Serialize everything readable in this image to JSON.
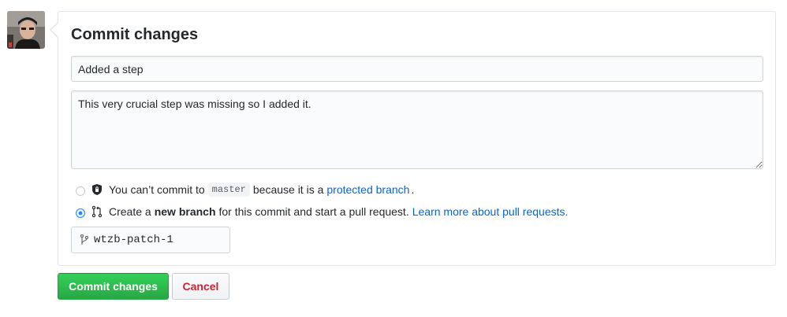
{
  "form": {
    "title": "Commit changes",
    "summary_value": "Added a step",
    "description_value": "This very crucial step was missing so I added it."
  },
  "options": {
    "direct_commit": {
      "text_before": "You can’t commit to",
      "branch": "master",
      "text_middle": "because it is a",
      "link": "protected branch",
      "text_after": "."
    },
    "new_branch": {
      "text_before": "Create a",
      "bold": "new branch",
      "text_middle": "for this commit and start a pull request.",
      "link": "Learn more about pull requests."
    }
  },
  "branch_name": "wtzb-patch-1",
  "buttons": {
    "commit": "Commit changes",
    "cancel": "Cancel"
  },
  "colors": {
    "primary": "#28a745",
    "link": "#0366d6",
    "cancel_text": "#cb2431",
    "radio_checked": "#2188ff"
  },
  "icons": [
    "avatar",
    "shield-lock-icon",
    "git-pull-request-icon",
    "git-branch-icon"
  ]
}
